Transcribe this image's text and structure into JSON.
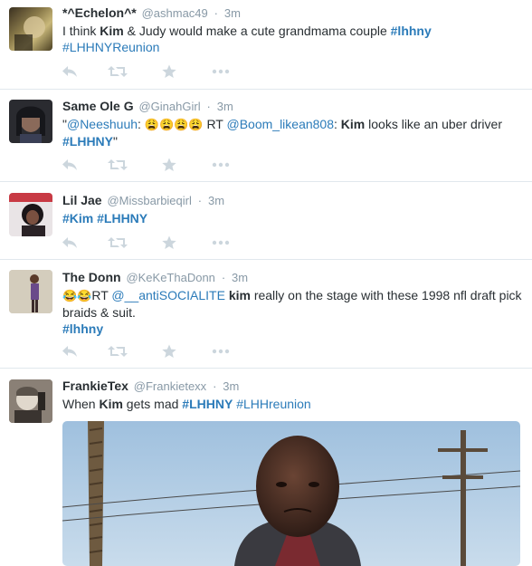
{
  "colors": {
    "link": "#2b7bb9",
    "meta": "#8899a6",
    "text": "#292f33",
    "action": "#ccd6dd",
    "divider": "#e1e8ed"
  },
  "tweets": [
    {
      "fullname": "*^Echelon^*",
      "username": "@ashmac49",
      "time": "3m",
      "t1": "I think ",
      "kim": "Kim",
      "t2": " & Judy would make a cute grandmama couple ",
      "tag1": "#lhhny",
      "tag2": "#LHHNYReunion"
    },
    {
      "fullname": "Same Ole G",
      "username": "@GinahGirl",
      "time": "3m",
      "q": "\"",
      "mention1": "@Neeshuuh",
      "colon": ":",
      "emoji": "😩😩😩😩",
      "rt": " RT ",
      "mention2": "@Boom_likean808",
      "colon2": ": ",
      "kim": "Kim",
      "t2": " looks like an uber driver",
      "tag1": "#LHHNY",
      "q2": "\""
    },
    {
      "fullname": "Lil Jae",
      "username": "@Missbarbieqirl",
      "time": "3m",
      "tag1": "#Kim",
      "tag2": "#LHHNY"
    },
    {
      "fullname": "The Donn",
      "username": "@KeKeThaDonn",
      "time": "3m",
      "emoji": "😂😂",
      "rt": "RT ",
      "mention1": "@__antiSOCIALITE",
      "kim": "kim",
      "t2": " really on the stage with these 1998 nfl draft pick braids & suit.",
      "tag1": "#lhhny"
    },
    {
      "fullname": "FrankieTex",
      "username": "@Frankietexx",
      "time": "3m",
      "t1": "When ",
      "kim": "Kim",
      "t2": " gets mad ",
      "tag1": "#LHHNY",
      "tag2": "#LHHreunion"
    }
  ],
  "sep": "·",
  "action_icons": [
    "reply-icon",
    "retweet-icon",
    "favorite-icon",
    "more-icon"
  ]
}
